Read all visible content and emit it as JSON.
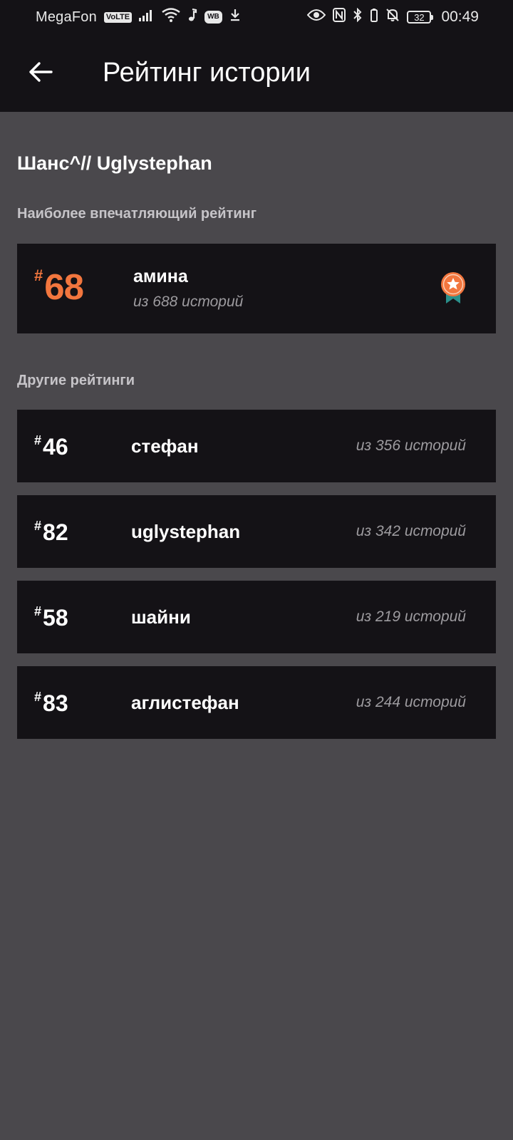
{
  "status_bar": {
    "carrier": "MegaFon",
    "volte": "VoLTE",
    "wb": "WB",
    "battery": "32",
    "time": "00:49"
  },
  "header": {
    "title": "Рейтинг истории"
  },
  "story": {
    "name": "Шанс^// Uglystephan"
  },
  "sections": {
    "top_label": "Наиболее впечатляющий рейтинг",
    "others_label": "Другие рейтинги"
  },
  "featured": {
    "hash": "#",
    "rank": "68",
    "name": "амина",
    "count": "из 688 историй",
    "accent_color": "#f2763e"
  },
  "others": [
    {
      "hash": "#",
      "rank": "46",
      "name": "стефан",
      "count": "из 356 историй"
    },
    {
      "hash": "#",
      "rank": "82",
      "name": "uglystephan",
      "count": "из 342 историй"
    },
    {
      "hash": "#",
      "rank": "58",
      "name": "шайни",
      "count": "из 219 историй"
    },
    {
      "hash": "#",
      "rank": "83",
      "name": "аглистефан",
      "count": "из 244 историй"
    }
  ]
}
